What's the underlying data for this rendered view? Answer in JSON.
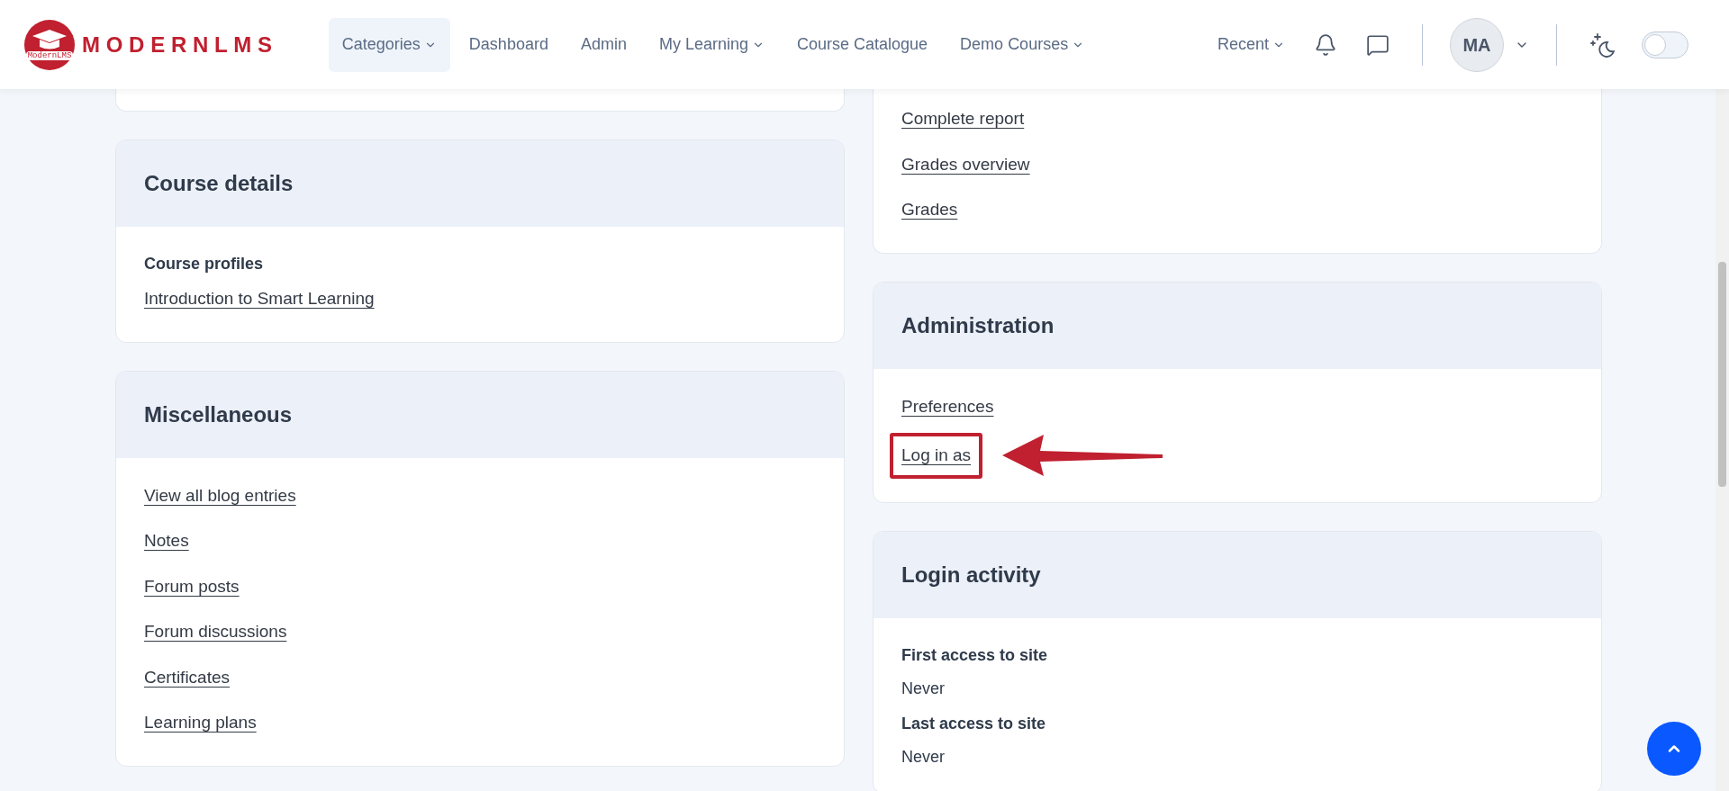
{
  "header": {
    "logo": {
      "wordmark": "MODERNLMS",
      "caption": "ModernLMS"
    },
    "nav": [
      {
        "label": "Categories",
        "dropdown": true,
        "selected": true
      },
      {
        "label": "Dashboard",
        "dropdown": false,
        "selected": false
      },
      {
        "label": "Admin",
        "dropdown": false,
        "selected": false
      },
      {
        "label": "My Learning",
        "dropdown": true,
        "selected": false
      },
      {
        "label": "Course Catalogue",
        "dropdown": false,
        "selected": false
      },
      {
        "label": "Demo Courses",
        "dropdown": true,
        "selected": false
      }
    ],
    "recent": "Recent",
    "avatar": "MA",
    "dark_mode": {
      "on": false
    }
  },
  "left_column": [
    {
      "kind": "clipped"
    },
    {
      "kind": "panel",
      "title": "Course details",
      "items": [
        {
          "kind": "heading",
          "text": "Course profiles"
        },
        {
          "kind": "link",
          "text": "Introduction to Smart Learning",
          "annotated": false
        }
      ]
    },
    {
      "kind": "panel",
      "title": "Miscellaneous",
      "items": [
        {
          "kind": "link",
          "text": "View all blog entries",
          "annotated": false
        },
        {
          "kind": "link",
          "text": "Notes",
          "annotated": false
        },
        {
          "kind": "link",
          "text": "Forum posts",
          "annotated": false
        },
        {
          "kind": "link",
          "text": "Forum discussions",
          "annotated": false
        },
        {
          "kind": "link",
          "text": "Certificates",
          "annotated": false
        },
        {
          "kind": "link",
          "text": "Learning plans",
          "annotated": false
        }
      ]
    }
  ],
  "right_column": [
    {
      "kind": "clipped",
      "items": [
        {
          "kind": "link",
          "text": "Complete report",
          "annotated": false
        },
        {
          "kind": "link",
          "text": "Grades overview",
          "annotated": false
        },
        {
          "kind": "link",
          "text": "Grades",
          "annotated": false
        }
      ]
    },
    {
      "kind": "panel",
      "title": "Administration",
      "items": [
        {
          "kind": "link",
          "text": "Preferences",
          "annotated": false
        },
        {
          "kind": "link",
          "text": "Log in as",
          "annotated": true
        }
      ]
    },
    {
      "kind": "panel",
      "title": "Login activity",
      "items": [
        {
          "kind": "heading",
          "text": "First access to site"
        },
        {
          "kind": "text",
          "text": "Never"
        },
        {
          "kind": "heading",
          "text": "Last access to site"
        },
        {
          "kind": "text",
          "text": "Never"
        }
      ]
    }
  ]
}
